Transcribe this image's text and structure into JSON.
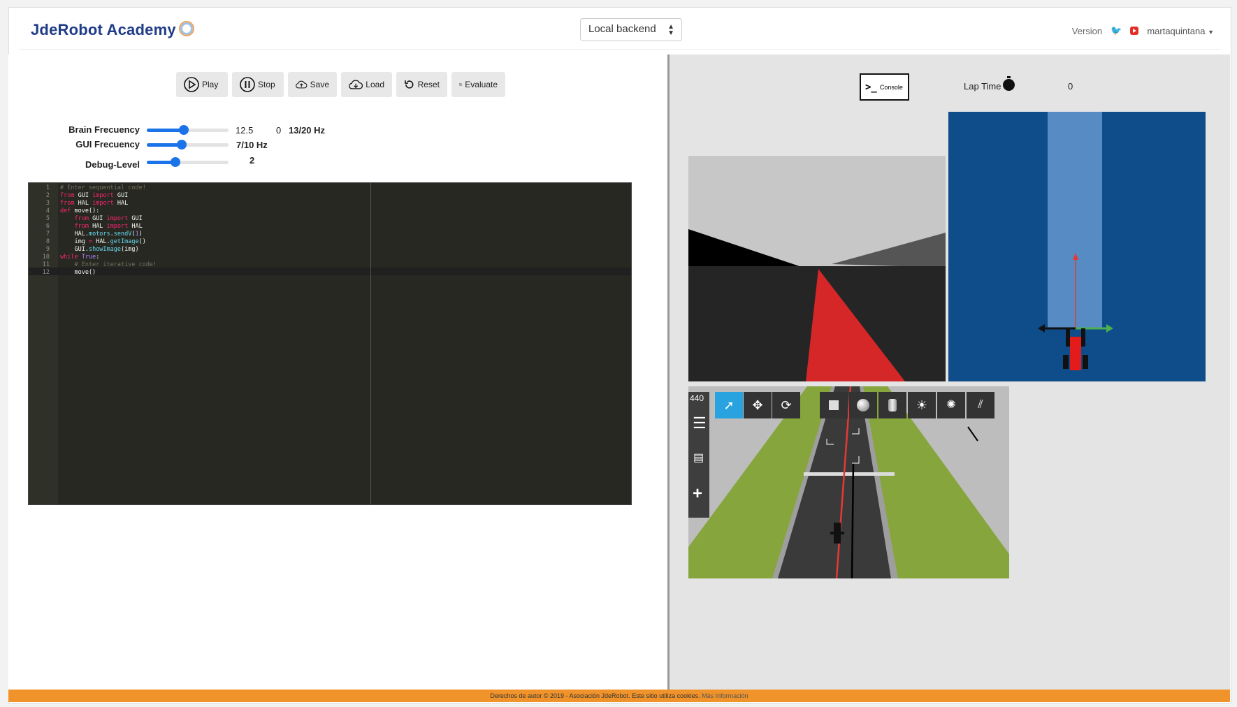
{
  "navbar": {
    "brand": "JdeRobot Academy",
    "backend": "Local backend",
    "version": "Version",
    "user": "martaquintana"
  },
  "toolbar": {
    "buttons": [
      {
        "label": "Play",
        "icon": "play-icon"
      },
      {
        "label": "Stop",
        "icon": "pause-icon"
      },
      {
        "label": "Save",
        "icon": "cloud-upload-icon"
      },
      {
        "label": "Load",
        "icon": "cloud-download-icon"
      },
      {
        "label": "Reset",
        "icon": "reset-icon"
      },
      {
        "label": "Evaluate",
        "icon": "evaluate-icon"
      }
    ]
  },
  "frequencies": {
    "brain": {
      "label": "Brain Frecuency",
      "value": "12.5",
      "measured": "0",
      "rate": "13/20 Hz",
      "level": 0.45
    },
    "gui": {
      "label": "GUI Frecuency",
      "rate": "7/10 Hz",
      "level": 0.43
    },
    "debug": {
      "label": "Debug-Level",
      "value": "2",
      "level": 0.35
    }
  },
  "editor": {
    "lines": [
      {
        "n": "1",
        "tokens": [
          {
            "t": "# Enter sequential code!",
            "c": "cm"
          }
        ]
      },
      {
        "n": "2",
        "tokens": [
          {
            "t": "from",
            "c": "kw"
          },
          {
            "t": " GUI ",
            "c": ""
          },
          {
            "t": "import",
            "c": "kw"
          },
          {
            "t": " GUI",
            "c": ""
          }
        ]
      },
      {
        "n": "3",
        "tokens": [
          {
            "t": "from",
            "c": "kw"
          },
          {
            "t": " HAL ",
            "c": ""
          },
          {
            "t": "import",
            "c": "kw"
          },
          {
            "t": " HAL",
            "c": ""
          }
        ]
      },
      {
        "n": "4",
        "tokens": [
          {
            "t": "def",
            "c": "kw"
          },
          {
            "t": " move():",
            "c": ""
          }
        ]
      },
      {
        "n": "5",
        "tokens": [
          {
            "t": "    from",
            "c": "kw"
          },
          {
            "t": " GUI ",
            "c": ""
          },
          {
            "t": "import",
            "c": "kw"
          },
          {
            "t": " GUI",
            "c": ""
          }
        ]
      },
      {
        "n": "6",
        "tokens": [
          {
            "t": "    from",
            "c": "kw"
          },
          {
            "t": " HAL ",
            "c": ""
          },
          {
            "t": "import",
            "c": "kw"
          },
          {
            "t": " HAL",
            "c": ""
          }
        ]
      },
      {
        "n": "7",
        "tokens": [
          {
            "t": "    HAL.",
            "c": ""
          },
          {
            "t": "motors",
            "c": "fn"
          },
          {
            "t": ".",
            "c": ""
          },
          {
            "t": "sendV",
            "c": "fn"
          },
          {
            "t": "(",
            "c": ""
          },
          {
            "t": "1",
            "c": "nm"
          },
          {
            "t": ")",
            "c": ""
          }
        ]
      },
      {
        "n": "8",
        "tokens": [
          {
            "t": "    img ",
            "c": ""
          },
          {
            "t": "=",
            "c": "kw"
          },
          {
            "t": " HAL.",
            "c": ""
          },
          {
            "t": "getImage",
            "c": "fn"
          },
          {
            "t": "()",
            "c": ""
          }
        ]
      },
      {
        "n": "9",
        "tokens": [
          {
            "t": "    GUI.",
            "c": ""
          },
          {
            "t": "showImage",
            "c": "fn"
          },
          {
            "t": "(img)",
            "c": ""
          }
        ]
      },
      {
        "n": "10",
        "tokens": [
          {
            "t": "while",
            "c": "kw"
          },
          {
            "t": " ",
            "c": ""
          },
          {
            "t": "True",
            "c": "nm"
          },
          {
            "t": ":",
            "c": ""
          }
        ]
      },
      {
        "n": "11",
        "tokens": [
          {
            "t": "    # Enter iterative code!",
            "c": "cm"
          }
        ]
      },
      {
        "n": "12",
        "tokens": [
          {
            "t": "    move()",
            "c": ""
          }
        ]
      }
    ]
  },
  "right_panel": {
    "console_label": "Console",
    "lap_time_label": "Lap Time",
    "lap_time_value": "0",
    "sim_fps": "440",
    "sim_tools": [
      "select-icon",
      "translate-icon",
      "rotate-icon",
      "box-icon",
      "sphere-icon",
      "cylinder-icon",
      "point-light-icon",
      "spot-light-icon",
      "directional-light-icon"
    ]
  },
  "footer": {
    "text": "Derechos de autor © 2019 - Asociación JdeRobot. Este sitio utiliza cookies.",
    "link": "Más Información"
  },
  "colors": {
    "accent": "#1a73e8",
    "footer": "#f0932b",
    "brand": "#1f3c88",
    "line": "#e53935"
  }
}
